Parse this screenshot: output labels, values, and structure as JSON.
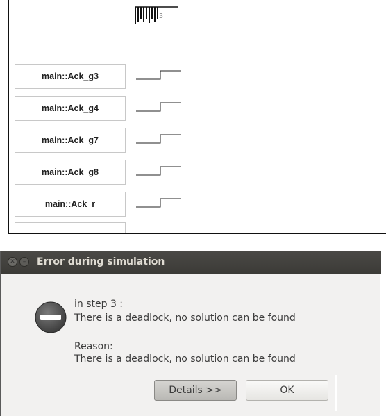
{
  "waveform": {
    "ruler_label": "3",
    "signals": [
      {
        "name": "main::Ack_g3"
      },
      {
        "name": "main::Ack_g4"
      },
      {
        "name": "main::Ack_g7"
      },
      {
        "name": "main::Ack_g8"
      },
      {
        "name": "main::Ack_r"
      }
    ]
  },
  "dialog": {
    "title": "Error during simulation",
    "icon": "stop-icon",
    "step_line": "in step 3 :",
    "message": "There is a deadlock, no solution can be found",
    "reason_label": "Reason:",
    "reason_text": "There is a deadlock, no solution can be found",
    "details_button": "Details >>",
    "ok_button": "OK"
  },
  "colors": {
    "titlebar": "#3c3b37",
    "dialog_bg": "#f2f1f0",
    "title_text": "#dfdbd2"
  }
}
